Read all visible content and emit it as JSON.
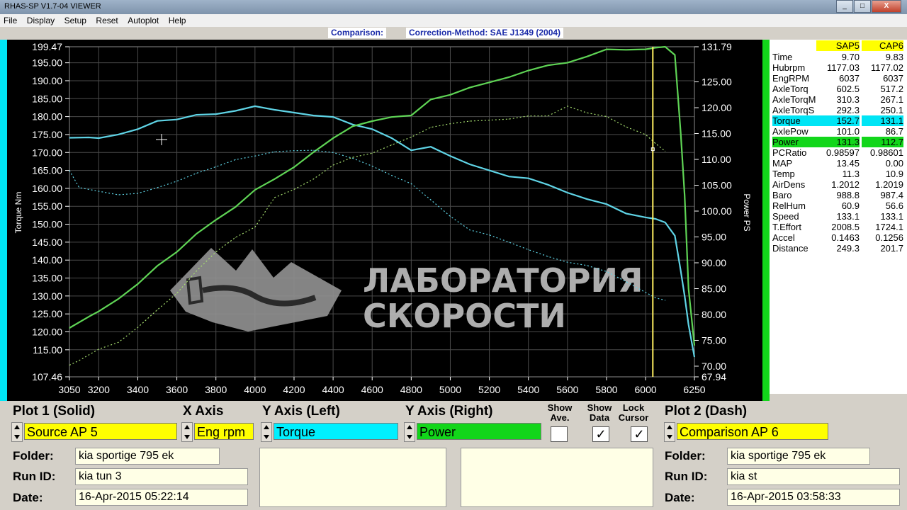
{
  "window": {
    "title": "RHAS-SP V1.7-04  VIEWER",
    "min": "_",
    "max": "□",
    "close": "X"
  },
  "menu": [
    "File",
    "Display",
    "Setup",
    "Reset",
    "Autoplot",
    "Help"
  ],
  "comparison_bar": {
    "label": "Comparison:",
    "method": "Correction-Method: SAE J1349 (2004)"
  },
  "chart_data": {
    "type": "line",
    "xlabel": "",
    "ylabel": "Torque Nm",
    "y2label": "Power PS",
    "xlim": [
      3050,
      6250
    ],
    "ylim": [
      107.46,
      199.47
    ],
    "y2lim": [
      67.94,
      131.79
    ],
    "x_ticks": [
      "3050",
      "3200",
      "3400",
      "3600",
      "3800",
      "4000",
      "4200",
      "4400",
      "4600",
      "4800",
      "5000",
      "5200",
      "5400",
      "5600",
      "5800",
      "6000",
      "6250"
    ],
    "y_ticks": [
      199.47,
      195,
      190,
      185,
      180,
      175,
      170,
      165,
      160,
      155,
      150,
      145,
      140,
      135,
      130,
      125,
      120,
      115,
      107.46
    ],
    "y2_ticks": [
      131.79,
      125,
      120,
      115,
      110,
      105,
      100,
      95,
      90,
      85,
      80,
      75,
      70,
      67.94
    ],
    "series": [
      {
        "name": "Torque",
        "plot": "Plot 1",
        "axis": "left",
        "style": "solid",
        "color": "#5fd4e6",
        "x": [
          3050,
          3150,
          3200,
          3300,
          3400,
          3500,
          3600,
          3700,
          3800,
          3900,
          4000,
          4100,
          4200,
          4300,
          4400,
          4500,
          4600,
          4700,
          4800,
          4900,
          5000,
          5100,
          5200,
          5300,
          5400,
          5500,
          5600,
          5700,
          5800,
          5900,
          6000,
          6050,
          6100,
          6150,
          6180,
          6200,
          6220,
          6250
        ],
        "y": [
          174.1,
          174.2,
          174.0,
          175.0,
          176.5,
          178.8,
          179.2,
          180.5,
          180.7,
          181.6,
          182.9,
          181.9,
          181.1,
          180.3,
          179.9,
          177.8,
          176.5,
          174.0,
          170.6,
          171.6,
          169.0,
          166.7,
          165.0,
          163.3,
          162.8,
          161.0,
          158.8,
          157.0,
          155.6,
          153.0,
          151.9,
          151.5,
          150.5,
          146.8,
          137.0,
          130.0,
          122.0,
          113.0
        ]
      },
      {
        "name": "Power",
        "plot": "Plot 1",
        "axis": "right",
        "style": "solid",
        "color": "#5fd455",
        "x": [
          3050,
          3150,
          3200,
          3300,
          3400,
          3500,
          3600,
          3700,
          3800,
          3900,
          4000,
          4100,
          4200,
          4300,
          4400,
          4500,
          4600,
          4700,
          4800,
          4900,
          5000,
          5100,
          5200,
          5300,
          5400,
          5500,
          5600,
          5700,
          5800,
          5900,
          6000,
          6050,
          6100,
          6150,
          6180,
          6200,
          6220,
          6250
        ],
        "y": [
          77.4,
          79.6,
          80.6,
          83.0,
          85.9,
          89.4,
          92.1,
          95.6,
          98.3,
          100.8,
          104.1,
          106.2,
          108.5,
          111.4,
          114.1,
          116.4,
          117.4,
          118.2,
          118.5,
          121.6,
          122.5,
          123.9,
          124.9,
          125.9,
          127.2,
          128.2,
          128.7,
          129.9,
          131.3,
          131.2,
          131.3,
          131.6,
          131.79,
          130.2,
          115.0,
          103.0,
          85.0,
          74.0
        ]
      },
      {
        "name": "Torque (Comparison AP 6)",
        "plot": "Plot 2",
        "axis": "left",
        "style": "dash",
        "color": "#5fd4e6",
        "x": [
          3050,
          3100,
          3200,
          3300,
          3400,
          3500,
          3600,
          3700,
          3800,
          3900,
          4000,
          4100,
          4200,
          4300,
          4400,
          4500,
          4600,
          4700,
          4800,
          4900,
          5000,
          5100,
          5200,
          5300,
          5400,
          5500,
          5600,
          5700,
          5800,
          5900,
          6000,
          6050,
          6100
        ],
        "y": [
          165.0,
          160.2,
          159.2,
          158.2,
          158.6,
          160.2,
          162.0,
          164.2,
          166.0,
          168.0,
          169.0,
          170.2,
          170.5,
          170.6,
          170.0,
          168.4,
          166.2,
          163.6,
          161.3,
          156.8,
          152.2,
          148.4,
          147.0,
          145.0,
          142.9,
          141.0,
          139.4,
          138.5,
          136.8,
          134.0,
          131.0,
          129.5,
          128.8
        ]
      },
      {
        "name": "Power (Comparison AP 6)",
        "plot": "Plot 2",
        "axis": "right",
        "style": "dash",
        "color": "#a8e070",
        "x": [
          3050,
          3100,
          3200,
          3300,
          3400,
          3500,
          3600,
          3700,
          3800,
          3900,
          4000,
          4100,
          4200,
          4300,
          4400,
          4500,
          4600,
          4700,
          4800,
          4900,
          5000,
          5100,
          5200,
          5300,
          5400,
          5500,
          5600,
          5700,
          5800,
          5900,
          6000,
          6050,
          6100
        ],
        "y": [
          70.2,
          71.1,
          73.3,
          74.6,
          77.5,
          80.9,
          84.1,
          88.4,
          92.1,
          94.9,
          96.9,
          102.6,
          104.2,
          106.2,
          108.9,
          110.4,
          111.2,
          112.8,
          114.3,
          116.2,
          116.9,
          117.4,
          117.6,
          117.8,
          118.4,
          118.4,
          120.3,
          119.0,
          118.3,
          116.3,
          114.8,
          113.1,
          111.6
        ]
      }
    ],
    "cursor_x": 6037,
    "grid": true
  },
  "watermark": {
    "line1": "ЛАБОРАТОРИЯ",
    "line2": "СКОРОСТИ"
  },
  "table": {
    "headers": [
      "",
      "SAP5",
      "CAP6"
    ],
    "rows": [
      {
        "label": "Time",
        "v1": "9.70",
        "v2": "9.83",
        "hl": ""
      },
      {
        "label": "Hubrpm",
        "v1": "1177.03",
        "v2": "1177.02",
        "hl": ""
      },
      {
        "label": "EngRPM",
        "v1": "6037",
        "v2": "6037",
        "hl": ""
      },
      {
        "label": "AxleTorq",
        "v1": "602.5",
        "v2": "517.2",
        "hl": ""
      },
      {
        "label": "AxleTorqM",
        "v1": "310.3",
        "v2": "267.1",
        "hl": ""
      },
      {
        "label": "AxleTorqS",
        "v1": "292.3",
        "v2": "250.1",
        "hl": ""
      },
      {
        "label": "Torque",
        "v1": "152.7",
        "v2": "131.1",
        "hl": "cyan"
      },
      {
        "label": "AxlePow",
        "v1": "101.0",
        "v2": "86.7",
        "hl": ""
      },
      {
        "label": "Power",
        "v1": "131.3",
        "v2": "112.7",
        "hl": "green"
      },
      {
        "label": "PCRatio",
        "v1": "0.98597",
        "v2": "0.98601",
        "hl": ""
      },
      {
        "label": "MAP",
        "v1": "13.45",
        "v2": "0.00",
        "hl": ""
      },
      {
        "label": "Temp",
        "v1": "11.3",
        "v2": "10.9",
        "hl": ""
      },
      {
        "label": "AirDens",
        "v1": "1.2012",
        "v2": "1.2019",
        "hl": ""
      },
      {
        "label": "Baro",
        "v1": "988.8",
        "v2": "987.4",
        "hl": ""
      },
      {
        "label": "RelHum",
        "v1": "60.9",
        "v2": "56.6",
        "hl": ""
      },
      {
        "label": "Speed",
        "v1": "133.1",
        "v2": "133.1",
        "hl": ""
      },
      {
        "label": "T.Effort",
        "v1": "2008.5",
        "v2": "1724.1",
        "hl": ""
      },
      {
        "label": "Accel",
        "v1": "0.1463",
        "v2": "0.1256",
        "hl": ""
      },
      {
        "label": "Distance",
        "v1": "249.3",
        "v2": "201.7",
        "hl": ""
      }
    ]
  },
  "controls": {
    "plot1_title": "Plot 1 (Solid)",
    "x_axis_title": "X Axis",
    "y_left_title": "Y Axis (Left)",
    "y_right_title": "Y Axis (Right)",
    "show_ave": "Show\nAve.",
    "show_data": "Show\nData",
    "lock_cursor": "Lock\nCursor",
    "plot2_title": "Plot 2 (Dash)",
    "plot1_source": "Source AP 5",
    "x_axis_value": "Eng rpm",
    "y_left_value": "Torque",
    "y_right_value": "Power",
    "plot2_source": "Comparison AP 6",
    "show_ave_checked": "",
    "show_data_checked": "✓",
    "lock_cursor_checked": "✓",
    "colors": {
      "plot1": "#ffff00",
      "xaxis": "#ffff00",
      "yleft": "#00f0ff",
      "yright": "#12d61a",
      "plot2": "#ffff00"
    }
  },
  "plot1_info": {
    "folder_label": "Folder:",
    "folder": "kia sportige 795 ek",
    "runid_label": "Run ID:",
    "runid": "kia tun 3",
    "date_label": "Date:",
    "date": "16-Apr-2015  05:22:14"
  },
  "plot2_info": {
    "folder_label": "Folder:",
    "folder": "kia sportige 795 ek",
    "runid_label": "Run ID:",
    "runid": "kia st",
    "date_label": "Date:",
    "date": "16-Apr-2015  03:58:33"
  }
}
